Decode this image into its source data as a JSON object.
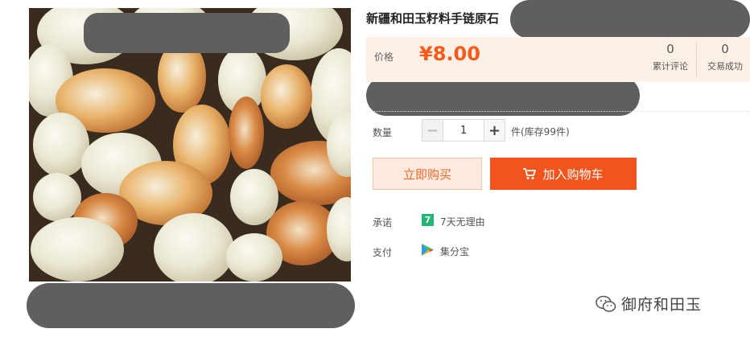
{
  "product": {
    "title": "新疆和田玉籽料手链原石"
  },
  "price": {
    "label": "价格",
    "value": "¥8.00"
  },
  "stats": {
    "reviews_count": "0",
    "reviews_label": "累计评论",
    "deals_count": "0",
    "deals_label": "交易成功"
  },
  "quantity": {
    "label": "数量",
    "value": "1",
    "minus": "−",
    "plus": "+",
    "stock_text": "件(库存99件)"
  },
  "actions": {
    "buy_now": "立即购买",
    "add_to_cart": "加入购物车"
  },
  "promise": {
    "label": "承诺",
    "icon_text": "7",
    "text": "7天无理由"
  },
  "payment": {
    "label": "支付",
    "text": "集分宝"
  },
  "watermark": {
    "text": "御府和田玉"
  },
  "colors": {
    "accent": "#f2541c",
    "price": "#f55b1a",
    "price_bg": "#fdf0e6",
    "promise_icon": "#22b573"
  },
  "icons": [
    "cart-icon",
    "seven-day-icon",
    "jifenbao-icon",
    "wechat-icon"
  ]
}
